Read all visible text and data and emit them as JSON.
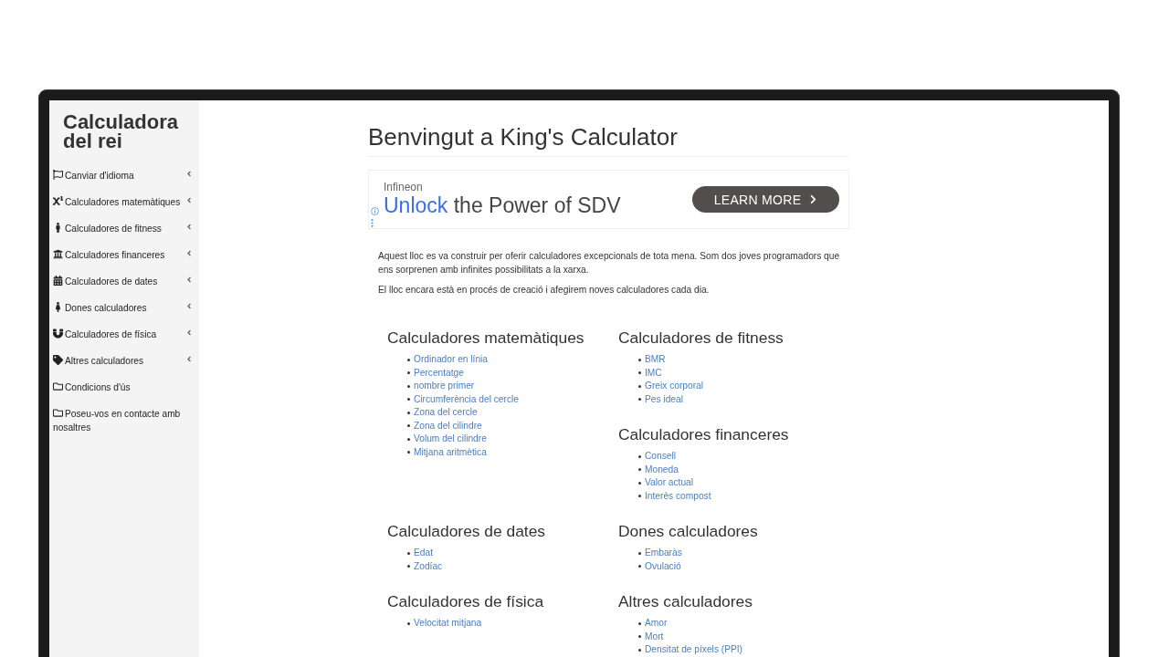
{
  "sidebar": {
    "title": "Calculadora del rei",
    "items": [
      {
        "label": "Canviar d'idioma",
        "kind": "submenu",
        "expanded": false
      },
      {
        "label": "Calculadores matemàtiques",
        "kind": "submenu",
        "expanded": false
      },
      {
        "label": "Calculadores de fitness",
        "kind": "submenu",
        "expanded": false
      },
      {
        "label": "Calculadores financeres",
        "kind": "submenu",
        "expanded": false
      },
      {
        "label": "Calculadores de dates",
        "kind": "submenu",
        "expanded": false
      },
      {
        "label": "Dones calculadores",
        "kind": "submenu",
        "expanded": false
      },
      {
        "label": "Calculadores de física",
        "kind": "submenu",
        "expanded": false
      },
      {
        "label": "Altres calculadores",
        "kind": "submenu",
        "expanded": false
      },
      {
        "label": "Condicions d'ús",
        "kind": "link"
      },
      {
        "label": "Poseu-vos en contacte amb nosaltres",
        "kind": "link"
      }
    ]
  },
  "main": {
    "heading": "Benvingut a King's Calculator",
    "ad": {
      "advertiser": "Infineon",
      "headline": [
        {
          "text": "Unlock",
          "highlight": true
        },
        {
          "text": "the Power of SDV",
          "highlight": false
        }
      ],
      "button": "LEARN MORE"
    },
    "paragraphs": [
      "Aquest lloc es va construir per oferir calculadores excepcionals de tota mena. Som dos joves programadors que ens sorprenen amb infinites possibilitats a la xarxa.",
      "El lloc encara està en procés de creació i afegirem noves calculadores cada dia."
    ],
    "section_rows": [
      {
        "columns": [
          [
            {
              "title": "Calculadores matemàtiques",
              "links": [
                "Ordinador en línia",
                "Percentatge",
                "nombre primer",
                "Circumferència del cercle",
                "Zona del cercle",
                "Zona del cilindre",
                "Volum del cilindre",
                "Mitjana aritmètica"
              ]
            }
          ],
          [
            {
              "title": "Calculadores de fitness",
              "links": [
                "BMR",
                "IMC",
                "Greix corporal",
                "Pes ideal"
              ]
            },
            {
              "title": "Calculadores financeres",
              "links": [
                "Consell",
                "Moneda",
                "Valor actual",
                "Interès compost"
              ]
            }
          ]
        ]
      },
      {
        "columns": [
          [
            {
              "title": "Calculadores de dates",
              "links": [
                "Edat",
                "Zodíac"
              ]
            }
          ],
          [
            {
              "title": "Dones calculadores",
              "links": [
                "Embaràs",
                "Ovulació"
              ]
            }
          ]
        ]
      },
      {
        "columns": [
          [
            {
              "title": "Calculadores de física",
              "links": [
                "Velocitat mitjana"
              ]
            }
          ],
          [
            {
              "title": "Altres calculadores",
              "links": [
                "Amor",
                "Mort",
                "Densitat de píxels (PPI)"
              ]
            }
          ]
        ]
      }
    ]
  }
}
